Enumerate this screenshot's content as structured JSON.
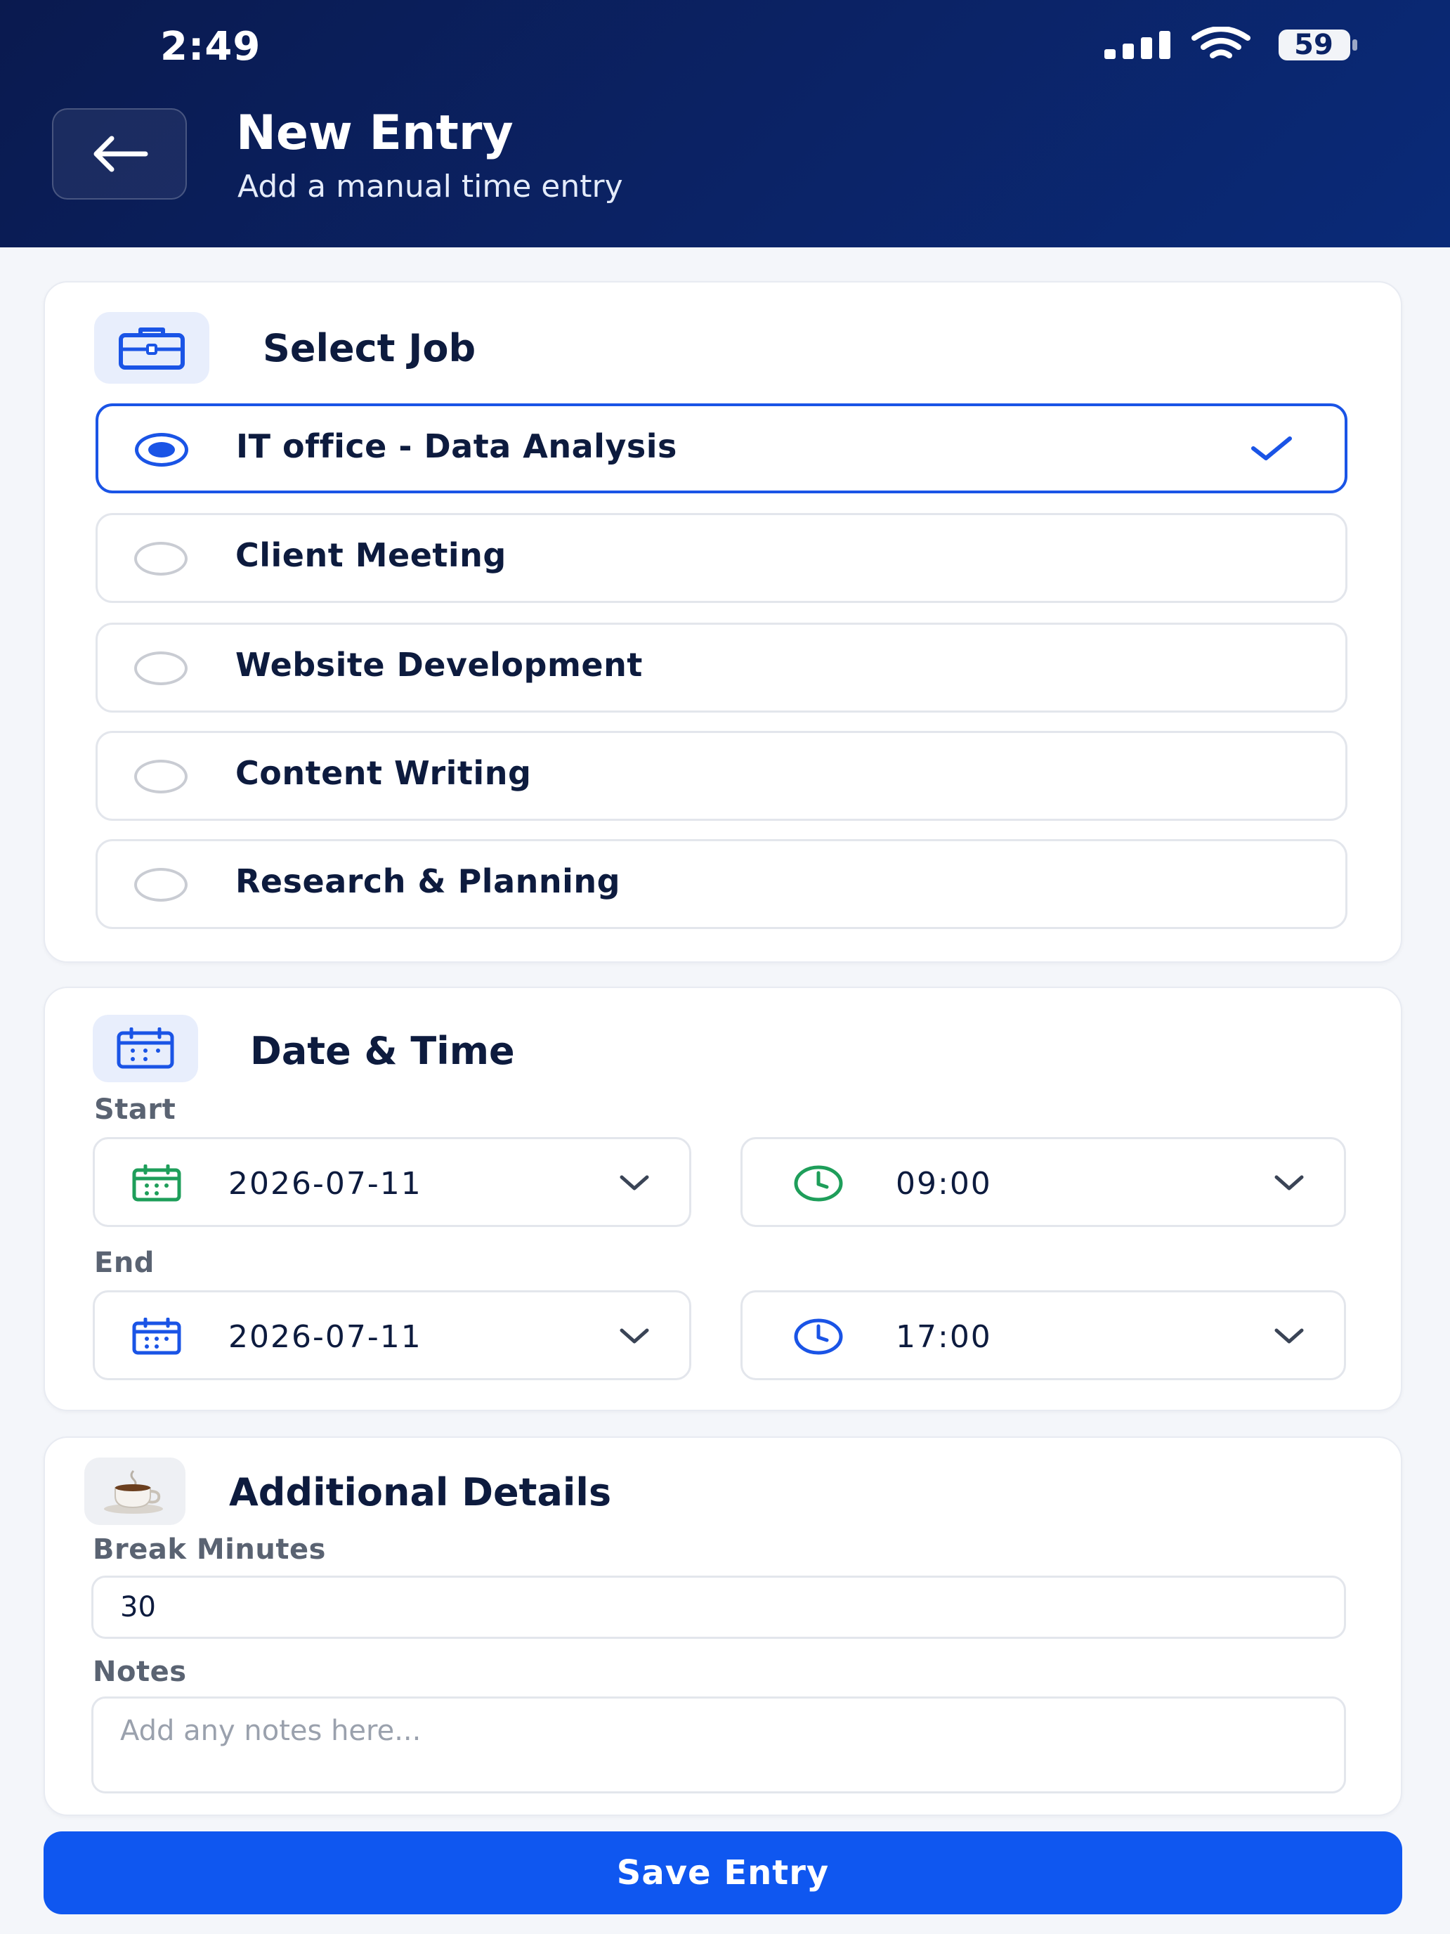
{
  "status_bar": {
    "time": "2:49",
    "battery": "59"
  },
  "header": {
    "title": "New Entry",
    "subtitle": "Add a manual time entry"
  },
  "job_section": {
    "title": "Select Job",
    "options": [
      {
        "label": "IT office - Data Analysis",
        "selected": true
      },
      {
        "label": "Client Meeting",
        "selected": false
      },
      {
        "label": "Website Development",
        "selected": false
      },
      {
        "label": "Content Writing",
        "selected": false
      },
      {
        "label": "Research & Planning",
        "selected": false
      }
    ]
  },
  "datetime_section": {
    "title": "Date & Time",
    "start_label": "Start",
    "start_date": "2026-07-11",
    "start_time": "09:00",
    "end_label": "End",
    "end_date": "2026-07-11",
    "end_time": "17:00"
  },
  "details_section": {
    "title": "Additional Details",
    "break_label": "Break Minutes",
    "break_value": "30",
    "notes_label": "Notes",
    "notes_placeholder": "Add any notes here..."
  },
  "save_button": {
    "label": "Save Entry"
  },
  "colors": {
    "accent": "#0f57f0",
    "header_bg": "#0b2366",
    "green": "#1e9e5a",
    "blue": "#1a54e6"
  },
  "icons": [
    "back-arrow-icon",
    "briefcase-icon",
    "check-icon",
    "calendar-icon",
    "clock-icon",
    "chevron-down-icon",
    "coffee-cup-icon"
  ]
}
